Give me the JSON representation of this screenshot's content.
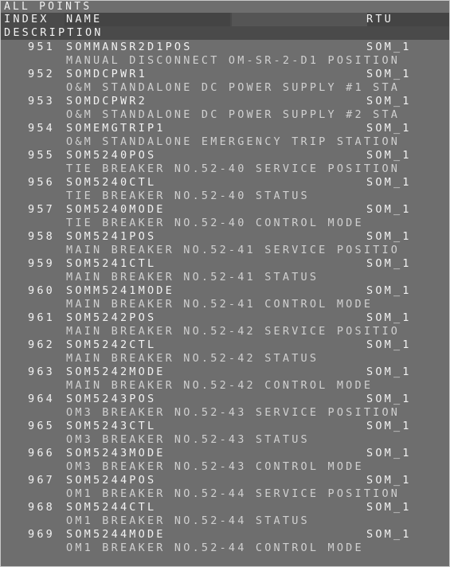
{
  "window": {
    "title": "ALL POINTS"
  },
  "header": {
    "index": "INDEX",
    "name": "NAME",
    "rtu": "RTU",
    "description": "DESCRIPTION"
  },
  "points": [
    {
      "index": "951",
      "name": "SOMMANSR2D1POS",
      "rtu": "SOM_1",
      "description": "MANUAL DISCONNECT OM-SR-2-D1 POSITION"
    },
    {
      "index": "952",
      "name": "SOMDCPWR1",
      "rtu": "SOM_1",
      "description": "O&M STANDALONE DC POWER SUPPLY #1 STA"
    },
    {
      "index": "953",
      "name": "SOMDCPWR2",
      "rtu": "SOM_1",
      "description": "O&M STANDALONE DC POWER SUPPLY #2 STA"
    },
    {
      "index": "954",
      "name": "SOMEMGTRIP1",
      "rtu": "SOM_1",
      "description": "O&M STANDALONE EMERGENCY TRIP STATION"
    },
    {
      "index": "955",
      "name": "SOM5240POS",
      "rtu": "SOM_1",
      "description": "TIE BREAKER NO.52-40 SERVICE POSITION"
    },
    {
      "index": "956",
      "name": "SOM5240CTL",
      "rtu": "SOM_1",
      "description": "TIE BREAKER NO.52-40 STATUS"
    },
    {
      "index": "957",
      "name": "SOM5240MODE",
      "rtu": "SOM_1",
      "description": "TIE BREAKER NO.52-40 CONTROL MODE"
    },
    {
      "index": "958",
      "name": "SOM5241POS",
      "rtu": "SOM_1",
      "description": "MAIN BREAKER NO.52-41 SERVICE POSITIO"
    },
    {
      "index": "959",
      "name": "SOM5241CTL",
      "rtu": "SOM_1",
      "description": "MAIN BREAKER NO.52-41 STATUS"
    },
    {
      "index": "960",
      "name": "SOMM5241MODE",
      "rtu": "SOM_1",
      "description": "MAIN BREAKER NO.52-41 CONTROL MODE"
    },
    {
      "index": "961",
      "name": "SOM5242POS",
      "rtu": "SOM_1",
      "description": "MAIN BREAKER NO.52-42 SERVICE POSITIO"
    },
    {
      "index": "962",
      "name": "SOM5242CTL",
      "rtu": "SOM_1",
      "description": "MAIN BREAKER NO.52-42 STATUS"
    },
    {
      "index": "963",
      "name": "SOM5242MODE",
      "rtu": "SOM_1",
      "description": "MAIN BREAKER NO.52-42 CONTROL MODE"
    },
    {
      "index": "964",
      "name": "SOM5243POS",
      "rtu": "SOM_1",
      "description": "OM3 BREAKER NO.52-43 SERVICE POSITION"
    },
    {
      "index": "965",
      "name": "SOM5243CTL",
      "rtu": "SOM_1",
      "description": "OM3 BREAKER NO.52-43 STATUS"
    },
    {
      "index": "966",
      "name": "SOM5243MODE",
      "rtu": "SOM_1",
      "description": "OM3 BREAKER NO.52-43 CONTROL MODE"
    },
    {
      "index": "967",
      "name": "SOM5244POS",
      "rtu": "SOM_1",
      "description": "OM1 BREAKER NO.52-44 SERVICE POSITION"
    },
    {
      "index": "968",
      "name": "SOM5244CTL",
      "rtu": "SOM_1",
      "description": "OM1 BREAKER NO.52-44 STATUS"
    },
    {
      "index": "969",
      "name": "SOM5244MODE",
      "rtu": "SOM_1",
      "description": "OM1 BREAKER NO.52-44 CONTROL MODE"
    }
  ]
}
